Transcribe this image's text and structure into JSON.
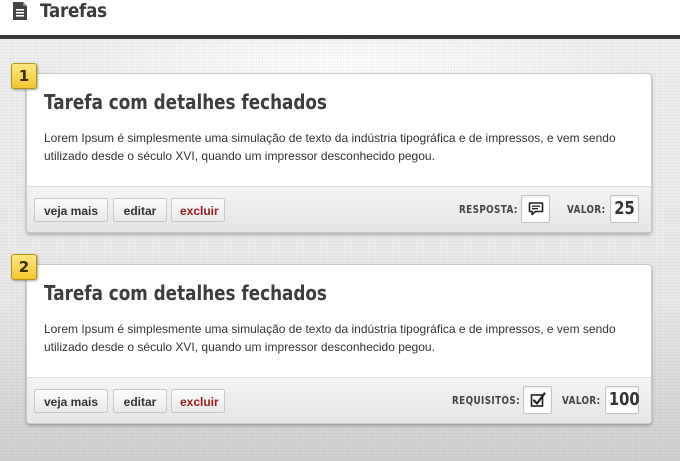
{
  "header": {
    "title": "Tarefas",
    "icon": "document-icon"
  },
  "tasks": [
    {
      "number": "1",
      "title": "Tarefa com detalhes fechados",
      "description": "Lorem Ipsum é simplesmente uma simulação de texto da indústria tipográfica e de impressos, e vem sendo utilizado desde o século XVI, quando um impressor desconhecido pegou.",
      "buttons": {
        "more": "veja mais",
        "edit": "editar",
        "delete": "excluir"
      },
      "meta_label": "RESPOSTA:",
      "meta_icon": "speech-bubble-icon",
      "value_label": "VALOR:",
      "value": "25"
    },
    {
      "number": "2",
      "title": "Tarefa com detalhes fechados",
      "description": "Lorem Ipsum é simplesmente uma simulação de texto da indústria tipográfica e de impressos, e vem sendo utilizado desde o século XVI, quando um impressor desconhecido pegou.",
      "buttons": {
        "more": "veja mais",
        "edit": "editar",
        "delete": "excluir"
      },
      "meta_label": "REQUISITOS:",
      "meta_icon": "checkbox-checked-icon",
      "value_label": "VALOR:",
      "value": "100"
    }
  ],
  "colors": {
    "badge": "#f2c630",
    "delete": "#9b1a1a",
    "topline": "#3a3a3a"
  }
}
